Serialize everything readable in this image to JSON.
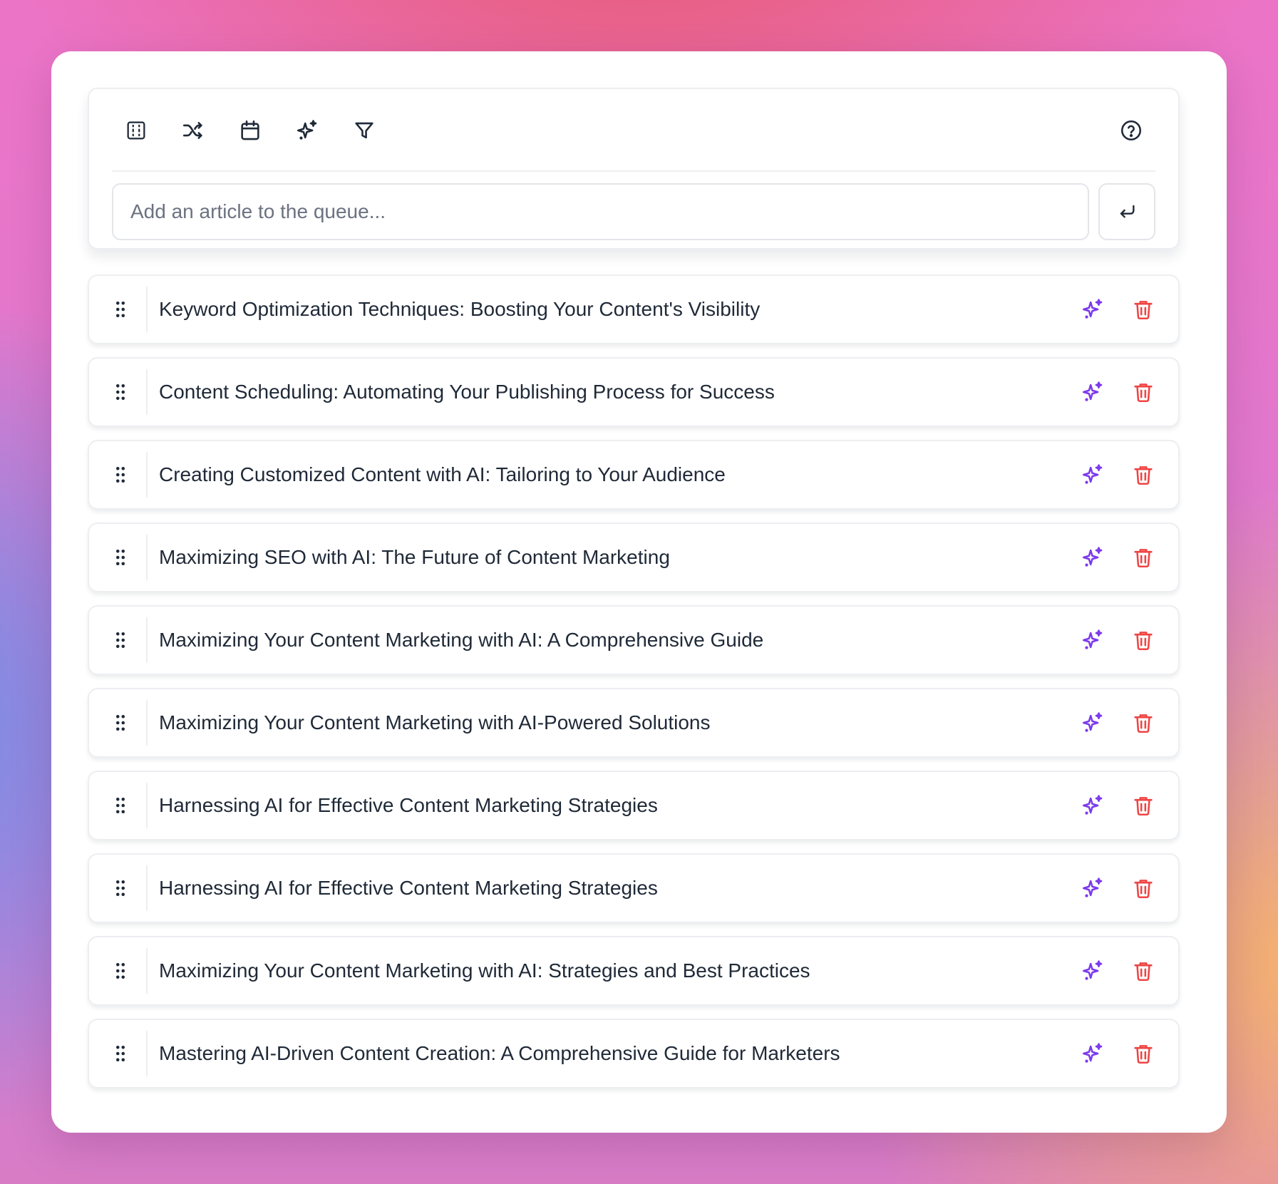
{
  "toolbar": {
    "tools": [
      {
        "icon": "table-icon",
        "name": "table-view-button"
      },
      {
        "icon": "shuffle-icon",
        "name": "shuffle-button"
      },
      {
        "icon": "calendar-icon",
        "name": "calendar-button"
      },
      {
        "icon": "sparkles-icon",
        "name": "ai-generate-button"
      },
      {
        "icon": "filter-icon",
        "name": "filter-button"
      }
    ],
    "help_icon": "help-circle-icon"
  },
  "queue_input": {
    "placeholder": "Add an article to the queue...",
    "value": "",
    "submit_icon": "enter-icon"
  },
  "colors": {
    "accent_purple": "#7c3aed",
    "danger_red": "#ef4444",
    "icon_dark": "#1f2937",
    "border": "#eceef1"
  },
  "queue": [
    {
      "title": "Keyword Optimization Techniques: Boosting Your Content's Visibility"
    },
    {
      "title": "Content Scheduling: Automating Your Publishing Process for Success"
    },
    {
      "title": "Creating Customized Content with AI: Tailoring to Your Audience"
    },
    {
      "title": "Maximizing SEO with AI: The Future of Content Marketing"
    },
    {
      "title": "Maximizing Your Content Marketing with AI: A Comprehensive Guide"
    },
    {
      "title": "Maximizing Your Content Marketing with AI-Powered Solutions"
    },
    {
      "title": "Harnessing AI for Effective Content Marketing Strategies"
    },
    {
      "title": "Harnessing AI for Effective Content Marketing Strategies"
    },
    {
      "title": "Maximizing Your Content Marketing with AI: Strategies and Best Practices"
    },
    {
      "title": "Mastering AI-Driven Content Creation: A Comprehensive Guide for Marketers"
    }
  ]
}
